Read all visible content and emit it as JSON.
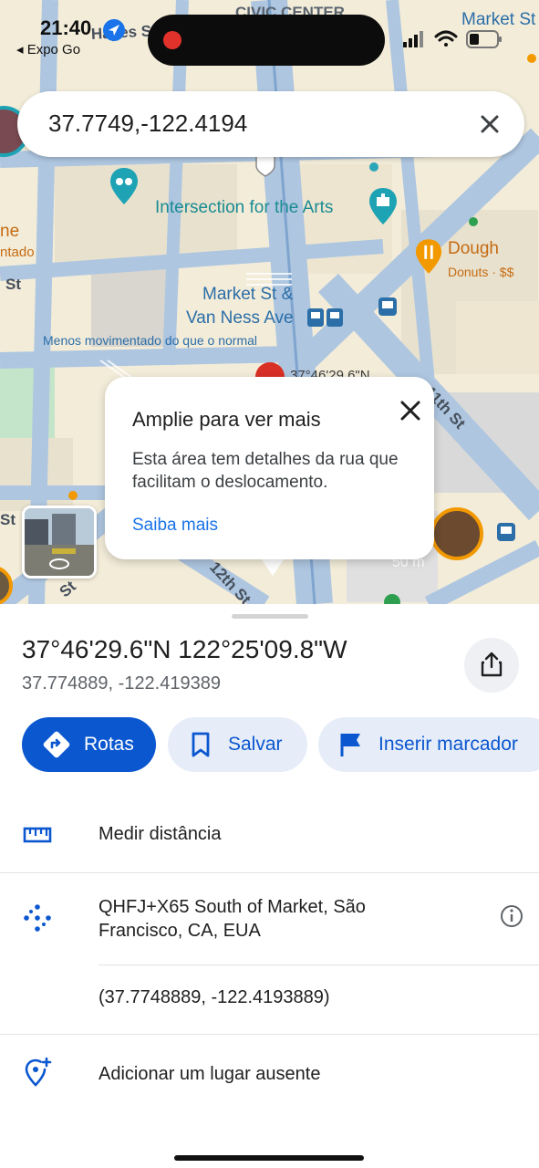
{
  "status_bar": {
    "time": "21:40",
    "back_app": "◂ Expo Go",
    "icons": [
      "location-arrow-icon",
      "record-icon",
      "cellular-icon",
      "wifi-icon",
      "battery-icon"
    ]
  },
  "search": {
    "query": "37.7749,-122.4194",
    "clear_icon": "close-icon"
  },
  "map": {
    "labels": {
      "civic_center": "CIVIC CENTER",
      "hayes": "Hayes St",
      "market_top": "Market St",
      "intersection_arts": "Intersection for the Arts",
      "dough": "Dough",
      "dough_sub": "Donuts · $$",
      "market_van_ness_1": "Market St &",
      "market_van_ness_2": "Van Ness Ave",
      "less_busy": "Menos movimentado do que o normal",
      "left_ne": "ne",
      "left_ntado": "ntado",
      "left_st": "St",
      "street_11th": "11th St",
      "street_12th": "12th St",
      "left_st2": "St",
      "left_st3": "St",
      "pin_label": "37°46'29.6\"N",
      "scale": "50 m"
    },
    "colors": {
      "street": "#aec6e0",
      "block": "#f3ecd9",
      "building": "#e6dfcc",
      "park": "#c4e5c9",
      "pin": "#d93025"
    }
  },
  "popup": {
    "title": "Amplie para ver mais",
    "body": "Esta área tem detalhes da rua que facilitam o deslocamento.",
    "link": "Saiba mais"
  },
  "sheet": {
    "coord_dms": "37°46'29.6\"N 122°25'09.8\"W",
    "coord_decimal": "37.774889, -122.419389",
    "actions": {
      "rotas": "Rotas",
      "salvar": "Salvar",
      "marcador": "Inserir marcador"
    },
    "rows": {
      "measure": "Medir distância",
      "plus_code_line1": "QHFJ+X65 South of Market, São",
      "plus_code_line2": "Francisco, CA, EUA",
      "precise_coords": "(37.7748889, -122.4193889)",
      "add_place": "Adicionar um lugar ausente"
    }
  },
  "accent_color": "#0b57d0"
}
